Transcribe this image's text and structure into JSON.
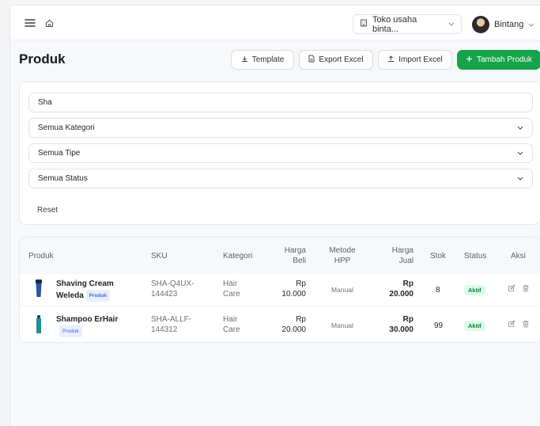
{
  "header": {
    "store_name": "Toko usaha binta...",
    "user_name": "Bintang"
  },
  "page": {
    "title": "Produk",
    "buttons": {
      "template": "Template",
      "export": "Export Excel",
      "import": "Import Excel",
      "add": "Tambah Produk"
    }
  },
  "filters": {
    "search_value": "Sha",
    "category": "Semua Kategori",
    "type": "Semua Tipe",
    "status": "Semua Status",
    "reset": "Reset"
  },
  "table": {
    "headers": {
      "product": "Produk",
      "sku": "SKU",
      "category": "Kategori",
      "buy_price_1": "Harga",
      "buy_price_2": "Beli",
      "method_1": "Metode",
      "method_2": "HPP",
      "sell_price_1": "Harga",
      "sell_price_2": "Jual",
      "stock": "Stok",
      "status": "Status",
      "actions": "Aksi"
    },
    "rows": [
      {
        "name_1": "Shaving Cream",
        "name_2": "Weleda",
        "type": "Produk",
        "sku_1": "SHA-Q4UX-",
        "sku_2": "144423",
        "cat_1": "Hair",
        "cat_2": "Care",
        "buy_1": "Rp",
        "buy_2": "10.000",
        "method": "Manual",
        "sell_1": "Rp",
        "sell_2": "20.000",
        "stock": "8",
        "status": "Aktif",
        "product_color": "#2b55a8"
      },
      {
        "name_1": "Shampoo ErHair",
        "type": "Produk",
        "sku_1": "SHA-ALLF-",
        "sku_2": "144312",
        "cat_1": "Hair",
        "cat_2": "Care",
        "buy_1": "Rp",
        "buy_2": "20.000",
        "method": "Manual",
        "sell_1": "Rp",
        "sell_2": "30.000",
        "stock": "99",
        "status": "Aktif",
        "product_color": "#1f8f9a"
      }
    ]
  },
  "icons": {
    "menu": "menu-icon",
    "home": "home-icon",
    "store": "store-icon",
    "download": "download-icon",
    "file": "file-icon",
    "upload": "upload-icon",
    "plus": "plus-icon",
    "edit": "edit-icon",
    "trash": "trash-icon"
  },
  "colors": {
    "accent": "#16a34a",
    "active_badge": "#dcfce7",
    "type_badge": "#e7efff"
  }
}
